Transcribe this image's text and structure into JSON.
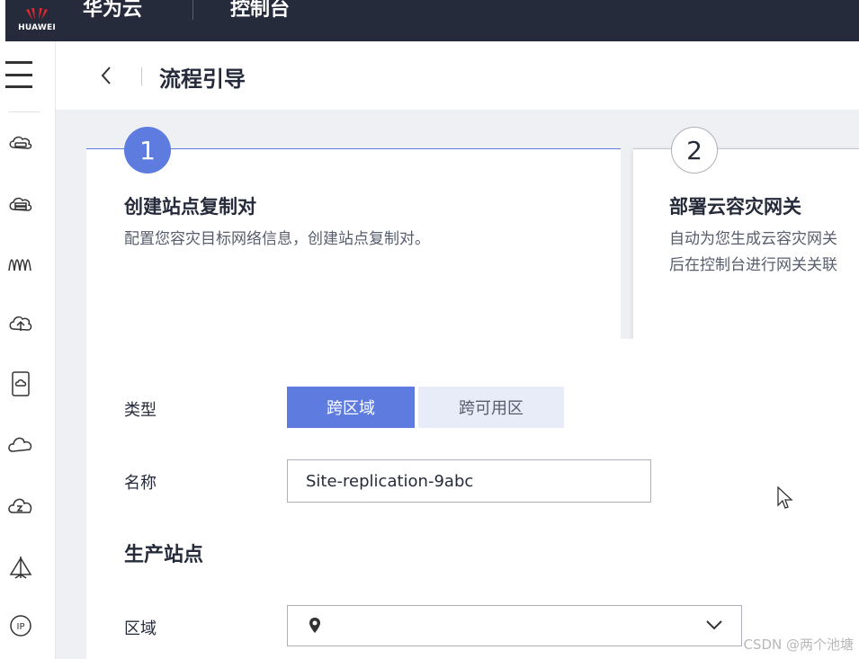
{
  "topbar": {
    "logo_text": "HUAWEI",
    "brand": "华为云",
    "console": "控制台"
  },
  "header": {
    "title": "流程引导"
  },
  "steps": [
    {
      "number": "1",
      "title": "创建站点复制对",
      "description_lines": [
        "配置您容灾目标网络信息，创建站点复制对。"
      ]
    },
    {
      "number": "2",
      "title": "部署云容灾网关",
      "description_lines": [
        "自动为您生成云容灾网关",
        "后在控制台进行网关关联"
      ]
    }
  ],
  "form": {
    "type_label": "类型",
    "type_options": [
      "跨区域",
      "跨可用区"
    ],
    "type_selected": "跨区域",
    "name_label": "名称",
    "name_value": "Site-replication-9abc",
    "production_site_title": "生产站点",
    "region_label": "区域",
    "region_value": ""
  },
  "sidebar_icons": [
    "cloud-server-icon",
    "storage-icon",
    "network-wave-icon",
    "cloud-upload-icon",
    "backup-device-icon",
    "cloud-icon",
    "cloud-sync-icon",
    "tent-icon",
    "ip-icon"
  ],
  "watermark": "CSDN @两个池塘",
  "colors": {
    "accent": "#5e7ce0",
    "topbar": "#252b3a",
    "content_bg": "#eef0f4"
  }
}
